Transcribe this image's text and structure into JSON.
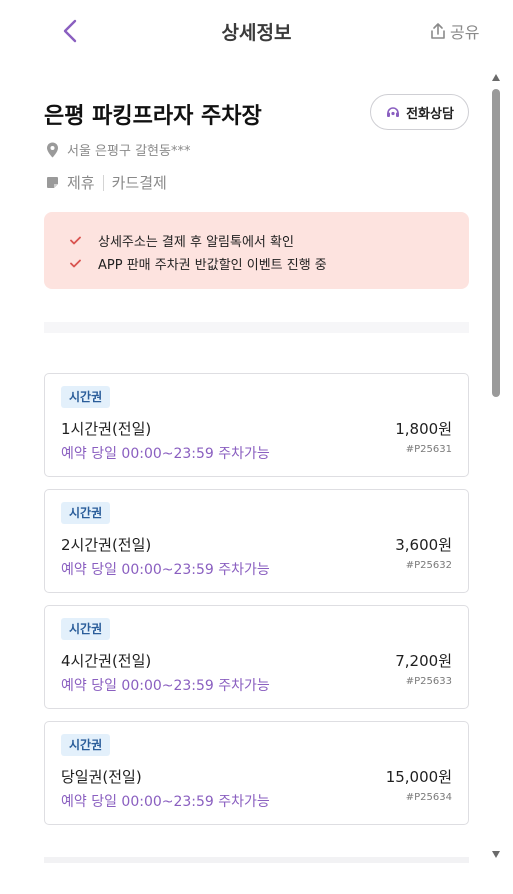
{
  "header": {
    "title": "상세정보",
    "share_label": "공유",
    "back_icon": "chevron-left-icon",
    "share_icon": "upload-share-icon"
  },
  "place": {
    "name": "은평 파킹프라자 주차장",
    "call_button_label": "전화상담",
    "address": "서울 은평구 갈현동***",
    "tags": [
      "제휴",
      "카드결제"
    ]
  },
  "notice": {
    "items": [
      "상세주소는 결제 후 알림톡에서 확인",
      "APP 판매 주차권 반값할인 이벤트 진행 중"
    ]
  },
  "tickets": [
    {
      "badge": "시간권",
      "name": "1시간권(전일)",
      "desc": "예약 당일 00:00~23:59 주차가능",
      "price": "1,800원",
      "code": "#P25631"
    },
    {
      "badge": "시간권",
      "name": "2시간권(전일)",
      "desc": "예약 당일 00:00~23:59 주차가능",
      "price": "3,600원",
      "code": "#P25632"
    },
    {
      "badge": "시간권",
      "name": "4시간권(전일)",
      "desc": "예약 당일 00:00~23:59 주차가능",
      "price": "7,200원",
      "code": "#P25633"
    },
    {
      "badge": "시간권",
      "name": "당일권(전일)",
      "desc": "예약 당일 00:00~23:59 주차가능",
      "price": "15,000원",
      "code": "#P25634"
    }
  ],
  "colors": {
    "accent_purple": "#8a5fc0",
    "notice_bg": "#fde3df",
    "check_red": "#d9534f",
    "badge_bg": "#e3f0fb"
  }
}
